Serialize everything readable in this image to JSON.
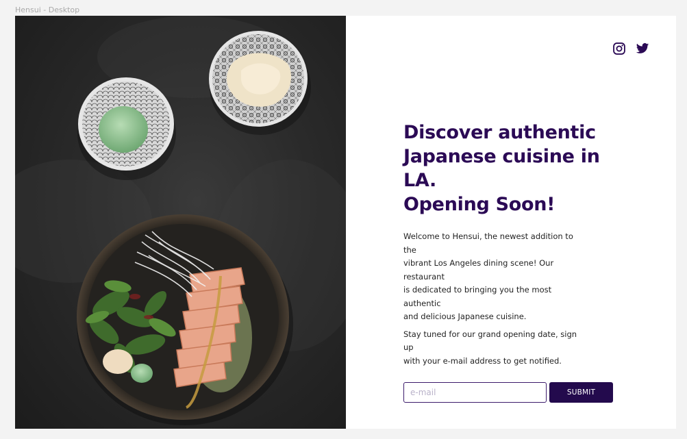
{
  "frame": {
    "label": "Hensui - Desktop"
  },
  "social": [
    {
      "name": "instagram",
      "icon": "instagram-icon"
    },
    {
      "name": "twitter",
      "icon": "twitter-icon"
    }
  ],
  "hero": {
    "headline_lines": [
      "Discover authentic",
      "Japanese cuisine in LA.",
      "Opening Soon!"
    ],
    "paragraph_1_lines": [
      "Welcome to Hensui, the newest addition to the",
      "vibrant Los Angeles dining scene! Our restaurant",
      "is dedicated to bringing you the most authentic",
      "and delicious Japanese cuisine."
    ],
    "paragraph_2_lines": [
      "Stay tuned for our grand opening date, sign up",
      "with your e-mail address to get notified."
    ]
  },
  "form": {
    "email_placeholder": "e-mail",
    "email_value": "",
    "submit_label": "SUBMIT"
  },
  "colors": {
    "brand_purple": "#2b0a55",
    "button_bg": "#230a4d",
    "page_bg": "#f3f3f3"
  }
}
